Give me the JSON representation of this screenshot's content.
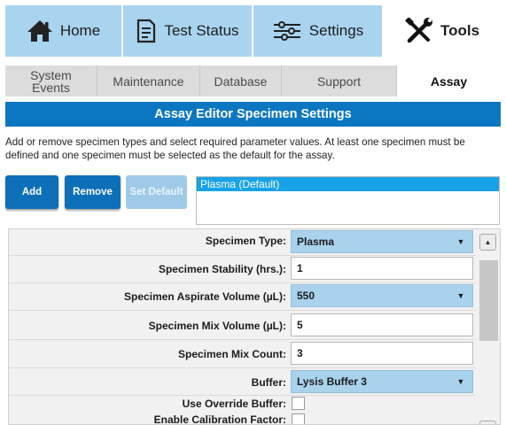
{
  "nav": {
    "tabs": [
      {
        "label": "Home",
        "icon": "home-icon"
      },
      {
        "label": "Test Status",
        "icon": "document-icon"
      },
      {
        "label": "Settings",
        "icon": "sliders-icon"
      },
      {
        "label": "Tools",
        "icon": "tools-icon",
        "active": true
      }
    ]
  },
  "subnav": {
    "tabs": [
      {
        "label_line1": "System",
        "label_line2": "Events"
      },
      {
        "label": "Maintenance"
      },
      {
        "label": "Database"
      },
      {
        "label": "Support"
      },
      {
        "label": "Assay",
        "active": true
      }
    ]
  },
  "header": {
    "title": "Assay Editor Specimen Settings"
  },
  "description": "Add or remove specimen types and select required parameter values. At least one specimen must be defined and one specimen must be selected as the default for the assay.",
  "buttons": {
    "add": "Add",
    "remove": "Remove",
    "set_default": "Set Default"
  },
  "specimen_list": {
    "items": [
      "Plasma (Default)"
    ],
    "selected_index": 0
  },
  "form": {
    "fields": [
      {
        "label": "Specimen Type:",
        "type": "select",
        "value": "Plasma"
      },
      {
        "label": "Specimen Stability (hrs.):",
        "type": "input",
        "value": "1"
      },
      {
        "label": "Specimen Aspirate Volume (µL):",
        "type": "select",
        "value": "550"
      },
      {
        "label": "Specimen Mix Volume (µL):",
        "type": "input",
        "value": "5"
      },
      {
        "label": "Specimen Mix Count:",
        "type": "input",
        "value": "3"
      },
      {
        "label": "Buffer:",
        "type": "select",
        "value": "Lysis Buffer 3"
      },
      {
        "label": "Use Override Buffer:",
        "type": "checkbox",
        "checked": false
      },
      {
        "label": "Enable Calibration Factor:",
        "type": "checkbox",
        "checked": false
      }
    ]
  },
  "colors": {
    "nav_tab": "#a9d4ef",
    "header": "#0c77c1",
    "button": "#0c6fb8",
    "button_disabled": "#9fcbe8",
    "list_selected": "#18a3e8",
    "select_bg": "#a9d2ec"
  }
}
